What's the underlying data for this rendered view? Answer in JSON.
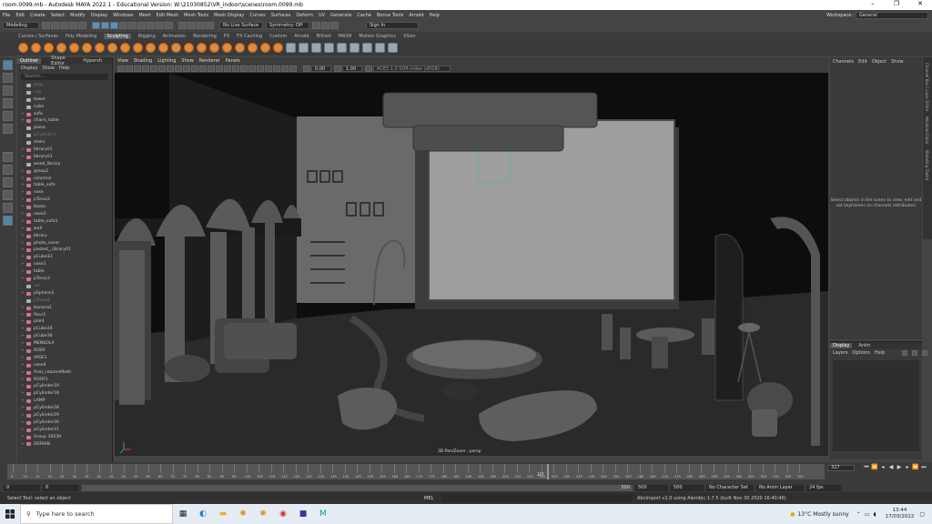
{
  "window": {
    "title": "room.0099.mb - Autodesk MAYA 2022.1 - Educational Version: W:\\21030852\\VR_indoor\\scenes\\room.0099.mb"
  },
  "menus": [
    "File",
    "Edit",
    "Create",
    "Select",
    "Modify",
    "Display",
    "Windows",
    "Mesh",
    "Edit Mesh",
    "Mesh Tools",
    "Mesh Display",
    "Curves",
    "Surfaces",
    "Deform",
    "UV",
    "Generate",
    "Cache",
    "Bonus Tools",
    "Arnold",
    "Help"
  ],
  "workspace": {
    "label": "Workspace:",
    "value": "General"
  },
  "statusline": {
    "mode": "Modeling",
    "no_live": "No Live Surface",
    "symmetry": "Symmetry: Off",
    "signin": "Sign In"
  },
  "shelf_tabs": [
    "Curves / Surfaces",
    "Poly Modeling",
    "Sculpting",
    "Rigging",
    "Animation",
    "Rendering",
    "FX",
    "FX Caching",
    "Custom",
    "Arnold",
    "Bifrost",
    "MASH",
    "Motion Graphics",
    "XGen"
  ],
  "shelf_active": "Sculpting",
  "outliner": {
    "tabs": [
      "Outliner",
      "Shape Editor",
      "Hypersh"
    ],
    "menu": [
      "Display",
      "Show",
      "Help"
    ],
    "search_placeholder": "Search...",
    "items": [
      {
        "label": "plug",
        "dim": true,
        "grp": false
      },
      {
        "label": "cup",
        "dim": true,
        "grp": false
      },
      {
        "label": "towel",
        "dim": false,
        "grp": false
      },
      {
        "label": "cube",
        "dim": false,
        "grp": false
      },
      {
        "label": "sofa",
        "dim": false,
        "grp": true
      },
      {
        "label": "chairs_table",
        "dim": false,
        "grp": true
      },
      {
        "label": "piano",
        "dim": false,
        "grp": false
      },
      {
        "label": "pCylinder1",
        "dim": true,
        "grp": false
      },
      {
        "label": "stairs",
        "dim": false,
        "grp": false
      },
      {
        "label": "library01",
        "dim": false,
        "grp": true
      },
      {
        "label": "library01",
        "dim": false,
        "grp": true
      },
      {
        "label": "wood_library",
        "dim": false,
        "grp": false
      },
      {
        "label": "group2",
        "dim": false,
        "grp": true
      },
      {
        "label": "columns",
        "dim": false,
        "grp": true
      },
      {
        "label": "table_sofa",
        "dim": false,
        "grp": true
      },
      {
        "label": "vase",
        "dim": false,
        "grp": true
      },
      {
        "label": "pTorus2",
        "dim": false,
        "grp": true
      },
      {
        "label": "books",
        "dim": false,
        "grp": true
      },
      {
        "label": "vase2",
        "dim": false,
        "grp": true
      },
      {
        "label": "table_sofa1",
        "dim": false,
        "grp": true
      },
      {
        "label": "wall",
        "dim": false,
        "grp": true
      },
      {
        "label": "library",
        "dim": false,
        "grp": true
      },
      {
        "label": "photo_cover",
        "dim": false,
        "grp": true
      },
      {
        "label": "pasted__library01",
        "dim": false,
        "grp": true
      },
      {
        "label": "pCube33",
        "dim": false,
        "grp": true
      },
      {
        "label": "vase1",
        "dim": false,
        "grp": true
      },
      {
        "label": "table",
        "dim": false,
        "grp": true
      },
      {
        "label": "pTorus3",
        "dim": false,
        "grp": true
      },
      {
        "label": "set",
        "dim": true,
        "grp": false
      },
      {
        "label": "pSphere3",
        "dim": false,
        "grp": true
      },
      {
        "label": "pTorus4",
        "dim": true,
        "grp": false
      },
      {
        "label": "banana1",
        "dim": false,
        "grp": true
      },
      {
        "label": "flour1",
        "dim": false,
        "grp": true
      },
      {
        "label": "plant",
        "dim": false,
        "grp": true
      },
      {
        "label": "pCube34",
        "dim": false,
        "grp": true
      },
      {
        "label": "pCube36",
        "dim": false,
        "grp": true
      },
      {
        "label": "MENSOLA",
        "dim": false,
        "grp": true
      },
      {
        "label": "ROOF",
        "dim": false,
        "grp": true
      },
      {
        "label": "VASE1",
        "dim": false,
        "grp": true
      },
      {
        "label": "vase4",
        "dim": false,
        "grp": true
      },
      {
        "label": "final_columnMesh",
        "dim": false,
        "grp": true
      },
      {
        "label": "ROOF1",
        "dim": false,
        "grp": true
      },
      {
        "label": "pCylinder19",
        "dim": false,
        "grp": true
      },
      {
        "label": "pCylinder18",
        "dim": false,
        "grp": true
      },
      {
        "label": "LAMP",
        "dim": false,
        "grp": true
      },
      {
        "label": "pCylinder28",
        "dim": false,
        "grp": true
      },
      {
        "label": "pCylinder29",
        "dim": false,
        "grp": true
      },
      {
        "label": "pCylinder30",
        "dim": false,
        "grp": true
      },
      {
        "label": "pCylinder31",
        "dim": false,
        "grp": true
      },
      {
        "label": "Group 35639",
        "dim": false,
        "grp": true
      },
      {
        "label": "SOFA08",
        "dim": false,
        "grp": true
      }
    ]
  },
  "viewport_menu": [
    "View",
    "Shading",
    "Lighting",
    "Show",
    "Renderer",
    "Panels"
  ],
  "viewport_fields": {
    "exposure": "0.00",
    "gamma": "1.00",
    "color_space": "ACES 1.0 SDR-video (sRGB)"
  },
  "viewport_label": "3D Pan/Zoom : persp",
  "channel_box": {
    "tabs": [
      "Channels",
      "Edit",
      "Object",
      "Show"
    ],
    "message": "Select objects in the scene to view, edit and set keyframes on channels (attributes)"
  },
  "layers": {
    "tabs": [
      "Display",
      "Anim"
    ],
    "menu": [
      "Layers",
      "Options",
      "Help"
    ]
  },
  "side_tabs": [
    "Channel Box / Layer Editor",
    "Attribute Editor",
    "Modelling Toolkit"
  ],
  "timeline": {
    "ticks": [
      "5",
      "10",
      "15",
      "20",
      "25",
      "30",
      "35",
      "40",
      "45",
      "50",
      "55",
      "60",
      "65",
      "70",
      "75",
      "80",
      "85",
      "90",
      "95",
      "100",
      "105",
      "110",
      "115",
      "120",
      "125",
      "130",
      "135",
      "140",
      "145",
      "150",
      "155",
      "160",
      "165",
      "170",
      "175",
      "180",
      "185",
      "190",
      "195",
      "200",
      "205",
      "210",
      "215",
      "220",
      "225",
      "230",
      "235",
      "240",
      "245",
      "250",
      "255",
      "260",
      "265",
      "270",
      "275",
      "280",
      "285",
      "290",
      "295",
      "300",
      "305",
      "310",
      "315",
      "320",
      "325"
    ],
    "current": "327",
    "current_frame_box": "327"
  },
  "range": {
    "start": "0",
    "start2": "0",
    "end_inner": "500",
    "end1": "500",
    "end2": "500",
    "character": "No Character Set",
    "anim_layer": "No Anim Layer",
    "fps": "24 fps"
  },
  "command": {
    "help": "Select Tool: select an object",
    "mel": "MEL",
    "output": "AbcImport v1.0 using Alembic 1.7.5 (built Nov 30 2020 16:40:46)"
  },
  "taskbar": {
    "search": "Type here to search",
    "weather": "13°C  Mostly sunny",
    "time": "13:44",
    "date": "17/03/2022"
  }
}
